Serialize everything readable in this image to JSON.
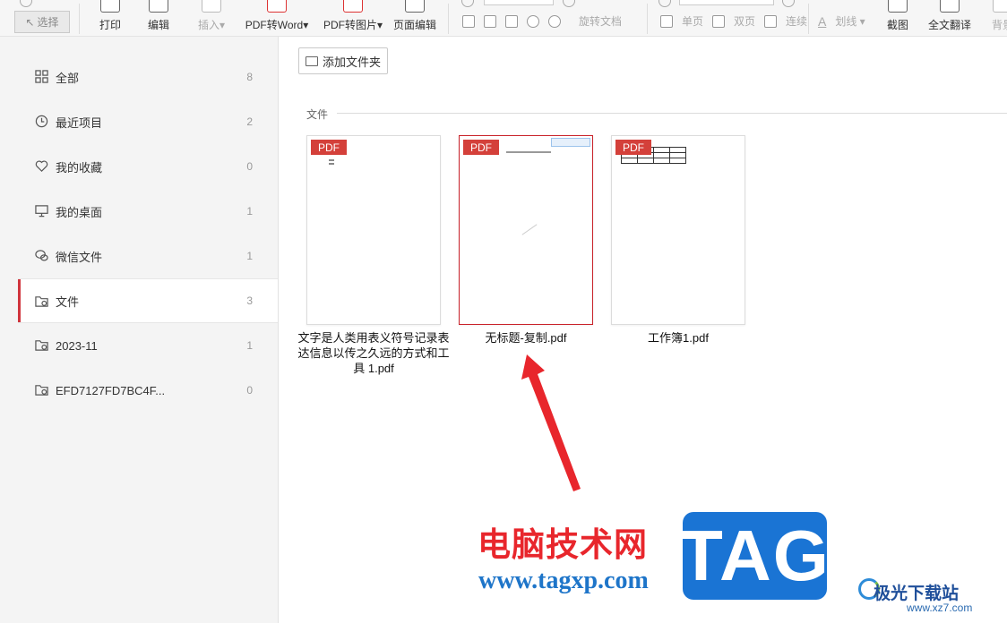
{
  "toolbar": {
    "select_label": "选择",
    "print_label": "打印",
    "edit_label": "编辑",
    "insert_label": "插入▾",
    "pdf_to_word_label": "PDF转Word▾",
    "pdf_to_image_label": "PDF转图片▾",
    "page_edit_label": "页面编辑",
    "rotate_label": "旋转文档",
    "single_page_label": "单页",
    "double_page_label": "双页",
    "continuous_label": "连续",
    "strikethrough_label": "划线 ▾",
    "screenshot_label": "截图",
    "translate_label": "全文翻译",
    "background_label": "背景"
  },
  "sidebar": {
    "items": [
      {
        "label": "全部",
        "count": "8"
      },
      {
        "label": "最近项目",
        "count": "2"
      },
      {
        "label": "我的收藏",
        "count": "0"
      },
      {
        "label": "我的桌面",
        "count": "1"
      },
      {
        "label": "微信文件",
        "count": "1"
      },
      {
        "label": "文件",
        "count": "3"
      },
      {
        "label": "2023-11",
        "count": "1"
      },
      {
        "label": "EFD7127FD7BC4F...",
        "count": "0"
      }
    ],
    "active_index": 5
  },
  "main": {
    "add_folder_label": "添加文件夹",
    "section_label": "文件",
    "files": [
      {
        "name": "文字是人类用表义符号记录表达信息以传之久远的方式和工具 1.pdf",
        "badge": "PDF"
      },
      {
        "name": "无标题-复制.pdf",
        "badge": "PDF",
        "selected": true
      },
      {
        "name": "工作簿1.pdf",
        "badge": "PDF"
      }
    ]
  },
  "watermark": {
    "site_cn": "电脑技术网",
    "site_url": "www.tagxp.com",
    "tag_text": "TAG",
    "jg_text": "极光下载站",
    "xz_url": "www.xz7.com"
  },
  "colors": {
    "accent_red": "#d0343c",
    "pdf_badge": "#d4403a",
    "arrow_red": "#e8262c",
    "tag_blue": "#1a74d4"
  }
}
